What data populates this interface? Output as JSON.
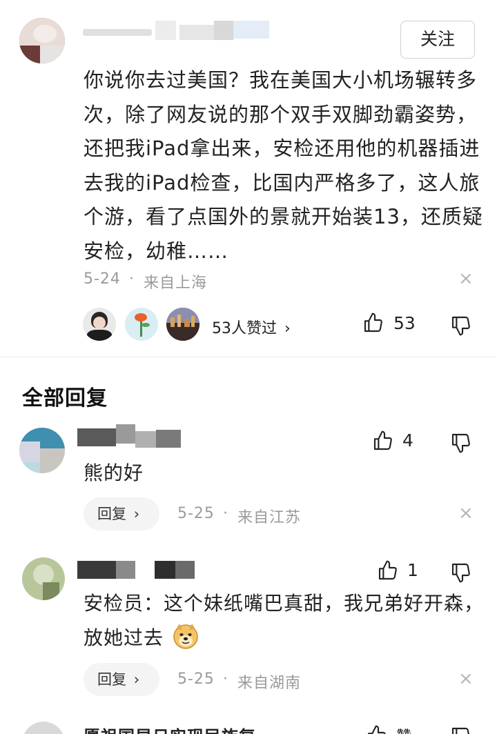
{
  "main_comment": {
    "follow_label": "关注",
    "text": "你说你去过美国？我在美国大小机场辗转多次，除了网友说的那个双手双脚劲霸姿势，还把我iPad拿出来，安检还用他的机器插进去我的iPad检查，比国内严格多了，这人旅个游，看了点国外的景就开始装13，还质疑安检，幼稚……",
    "date": "5-24",
    "separator": "·",
    "location": "来自上海",
    "likers_text": "53人赞过",
    "likers_chevron": "›",
    "like_count": "53",
    "close": "×"
  },
  "section_title": "全部回复",
  "replies": [
    {
      "text": "熊的好",
      "like_count": "4",
      "reply_label": "回复",
      "reply_chevron": "›",
      "date": "5-25",
      "separator": "·",
      "location": "来自江苏",
      "close": "×"
    },
    {
      "text": "安检员：这个妹纸嘴巴真甜，我兄弟好开森，放她过去",
      "emoji": "doge-emoji",
      "like_count": "1",
      "reply_label": "回复",
      "reply_chevron": "›",
      "date": "5-25",
      "separator": "·",
      "location": "来自湖南",
      "close": "×"
    }
  ],
  "partial_next": {
    "name": "愿祖国早日实现民族复",
    "like_label": "赞"
  },
  "colors": {
    "text": "#222222",
    "meta": "#9a9a9a",
    "divider": "#ececec",
    "reply_bg": "#f4f4f4"
  },
  "icons": [
    "thumb-up-icon",
    "thumb-down-icon",
    "close-icon",
    "chevron-right-icon",
    "doge-emoji"
  ]
}
